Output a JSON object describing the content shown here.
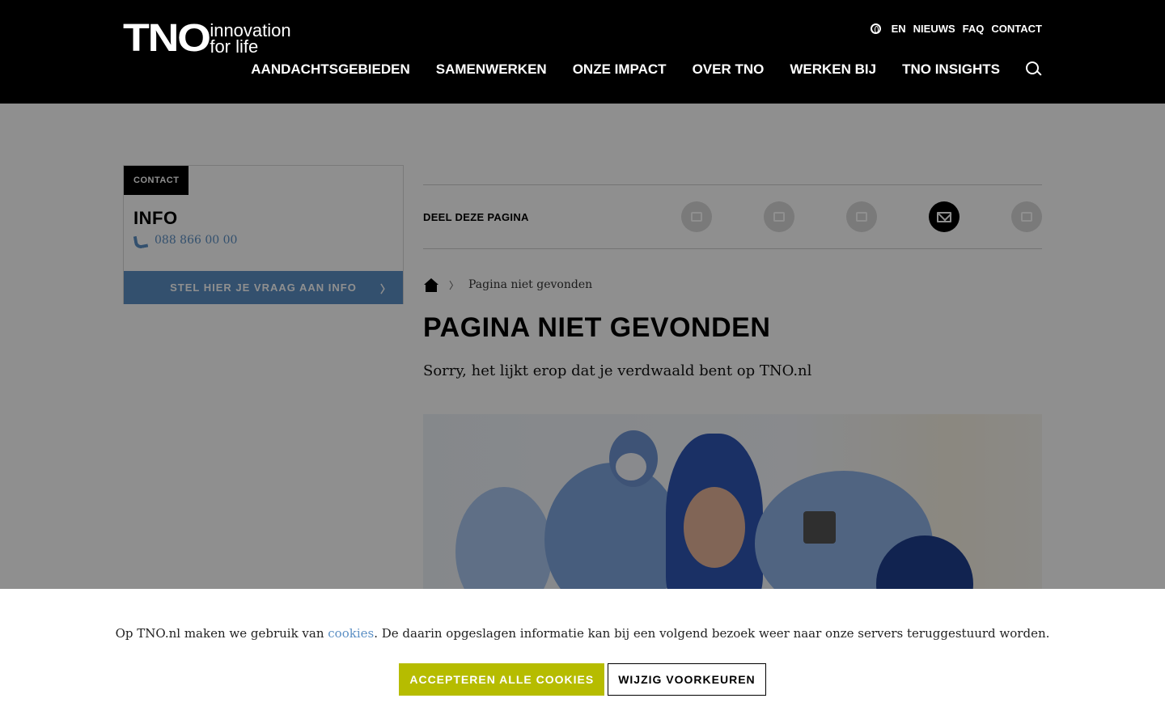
{
  "header": {
    "logo_mark": "TNO",
    "logo_tagline_1": "innovation",
    "logo_tagline_2": "for life",
    "top_links": [
      "EN",
      "NIEUWS",
      "FAQ",
      "CONTACT"
    ],
    "main_nav": [
      "AANDACHTSGEBIEDEN",
      "SAMENWERKEN",
      "ONZE IMPACT",
      "OVER TNO",
      "WERKEN BIJ",
      "TNO INSIGHTS"
    ]
  },
  "sidebar": {
    "tag": "CONTACT",
    "title": "INFO",
    "phone": "088 866 00 00",
    "button_label": "STEL HIER JE VRAAG AAN INFO",
    "button_chevron": "〉"
  },
  "share": {
    "label": "DEEL DEZE PAGINA",
    "icons": [
      "facebook-icon",
      "twitter-icon",
      "linkedin-icon",
      "mail-icon",
      "print-icon"
    ]
  },
  "breadcrumb": {
    "separator": "〉",
    "current": "Pagina niet gevonden"
  },
  "main": {
    "title": "PAGINA NIET GEVONDEN",
    "intro": "Sorry, het lijkt erop dat je verdwaald bent op TNO.nl"
  },
  "cookie": {
    "text_before": "Op TNO.nl maken we gebruik van ",
    "link": "cookies",
    "text_after": ". De daarin opgeslagen informatie kan bij een volgend bezoek weer naar onze servers teruggestuurd  worden.",
    "accept_label": "ACCEPTEREN ALLE COOKIES",
    "preferences_label": "WIJZIG VOORKEUREN"
  },
  "colors": {
    "accent_blue": "#5b8fc4",
    "accept_green": "#b6bc00",
    "header_bg": "#000000"
  }
}
